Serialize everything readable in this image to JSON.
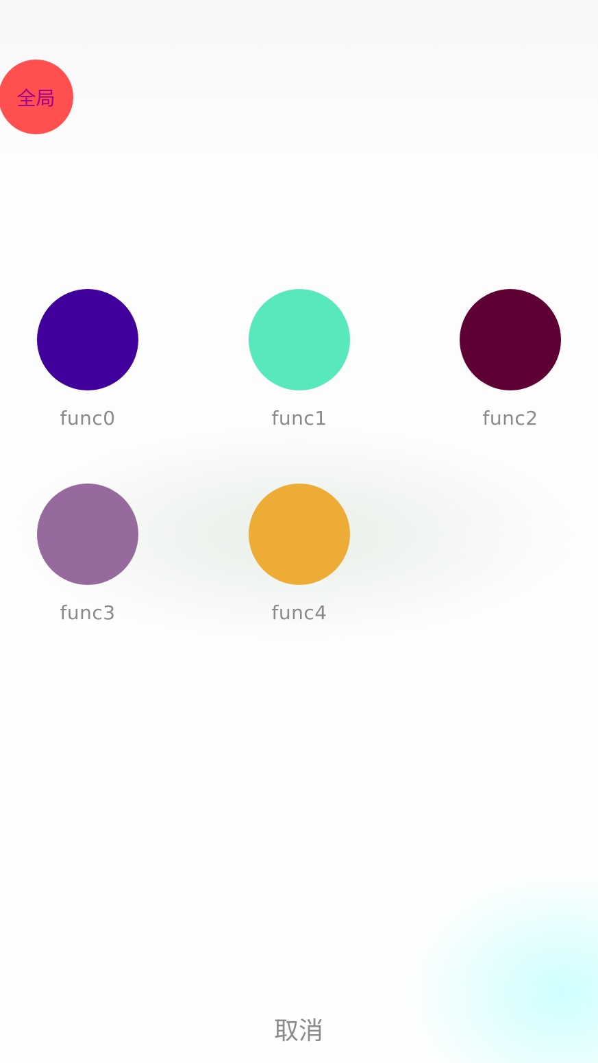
{
  "global_badge": {
    "label": "全局",
    "bg_color": "#ff4f4f",
    "text_color": "#9c008a"
  },
  "functions": [
    {
      "label": "func0",
      "color": "#40009c"
    },
    {
      "label": "func1",
      "color": "#57e8bd"
    },
    {
      "label": "func2",
      "color": "#5e0033"
    },
    {
      "label": "func3",
      "color": "#966a9c"
    },
    {
      "label": "func4",
      "color": "#edac36"
    }
  ],
  "cancel": {
    "label": "取消"
  }
}
